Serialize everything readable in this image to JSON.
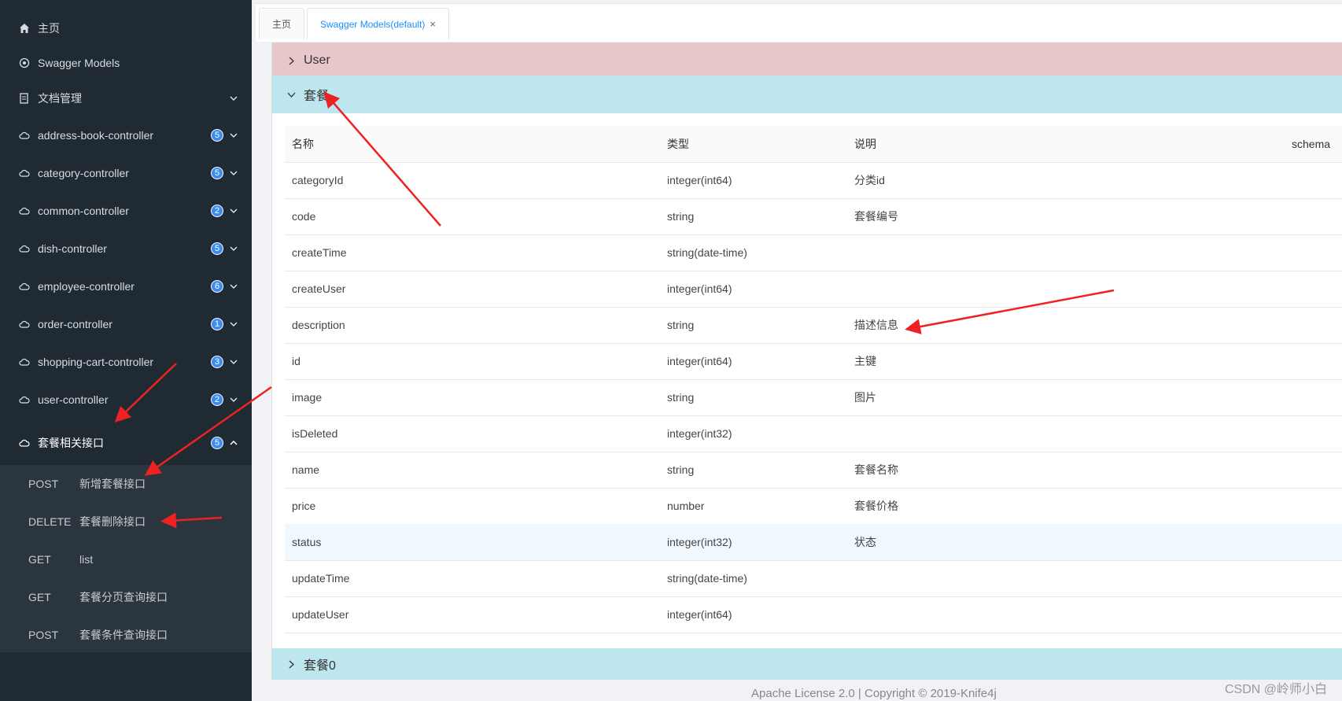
{
  "sidebar": {
    "nav": [
      {
        "label": "主页",
        "icon": "home-icon"
      },
      {
        "label": "Swagger Models",
        "icon": "cube-icon"
      },
      {
        "label": "文档管理",
        "icon": "document-icon"
      },
      {
        "label": "address-book-controller",
        "icon": "cloud-icon",
        "count": "5"
      },
      {
        "label": "category-controller",
        "icon": "cloud-icon",
        "count": "5"
      },
      {
        "label": "common-controller",
        "icon": "cloud-icon",
        "count": "2"
      },
      {
        "label": "dish-controller",
        "icon": "cloud-icon",
        "count": "5"
      },
      {
        "label": "employee-controller",
        "icon": "cloud-icon",
        "count": "6"
      },
      {
        "label": "order-controller",
        "icon": "cloud-icon",
        "count": "1"
      },
      {
        "label": "shopping-cart-controller",
        "icon": "cloud-icon",
        "count": "3"
      },
      {
        "label": "user-controller",
        "icon": "cloud-icon",
        "count": "2"
      },
      {
        "label": "套餐相关接口",
        "icon": "cloud-icon",
        "count": "5"
      }
    ],
    "submenu": [
      {
        "method": "POST",
        "path": "新增套餐接口"
      },
      {
        "method": "DELETE",
        "path": "套餐删除接口"
      },
      {
        "method": "GET",
        "path": "list"
      },
      {
        "method": "GET",
        "path": "套餐分页查询接口"
      },
      {
        "method": "POST",
        "path": "套餐条件查询接口"
      }
    ]
  },
  "tabs": [
    {
      "label": "主页"
    },
    {
      "label": "Swagger Models(default)",
      "close": "×"
    }
  ],
  "sections": {
    "user": "User",
    "combo": "套餐",
    "combo0": "套餐0"
  },
  "table": {
    "headers": {
      "name": "名称",
      "type": "类型",
      "desc": "说明",
      "schema": "schema"
    },
    "rows": [
      {
        "name": "categoryId",
        "type": "integer(int64)",
        "desc": "分类id"
      },
      {
        "name": "code",
        "type": "string",
        "desc": "套餐编号"
      },
      {
        "name": "createTime",
        "type": "string(date-time)",
        "desc": ""
      },
      {
        "name": "createUser",
        "type": "integer(int64)",
        "desc": ""
      },
      {
        "name": "description",
        "type": "string",
        "desc": "描述信息"
      },
      {
        "name": "id",
        "type": "integer(int64)",
        "desc": "主键"
      },
      {
        "name": "image",
        "type": "string",
        "desc": "图片"
      },
      {
        "name": "isDeleted",
        "type": "integer(int32)",
        "desc": ""
      },
      {
        "name": "name",
        "type": "string",
        "desc": "套餐名称"
      },
      {
        "name": "price",
        "type": "number",
        "desc": "套餐价格"
      },
      {
        "name": "status",
        "type": "integer(int32)",
        "desc": "状态"
      },
      {
        "name": "updateTime",
        "type": "string(date-time)",
        "desc": ""
      },
      {
        "name": "updateUser",
        "type": "integer(int64)",
        "desc": ""
      }
    ]
  },
  "footer": "Apache License 2.0 | Copyright © 2019-Knife4j",
  "watermark": "CSDN @岭师小白",
  "colors": {
    "sidebar_bg": "#1f2a33",
    "accent": "#1890ff",
    "annotation_arrow": "#ee2222"
  }
}
